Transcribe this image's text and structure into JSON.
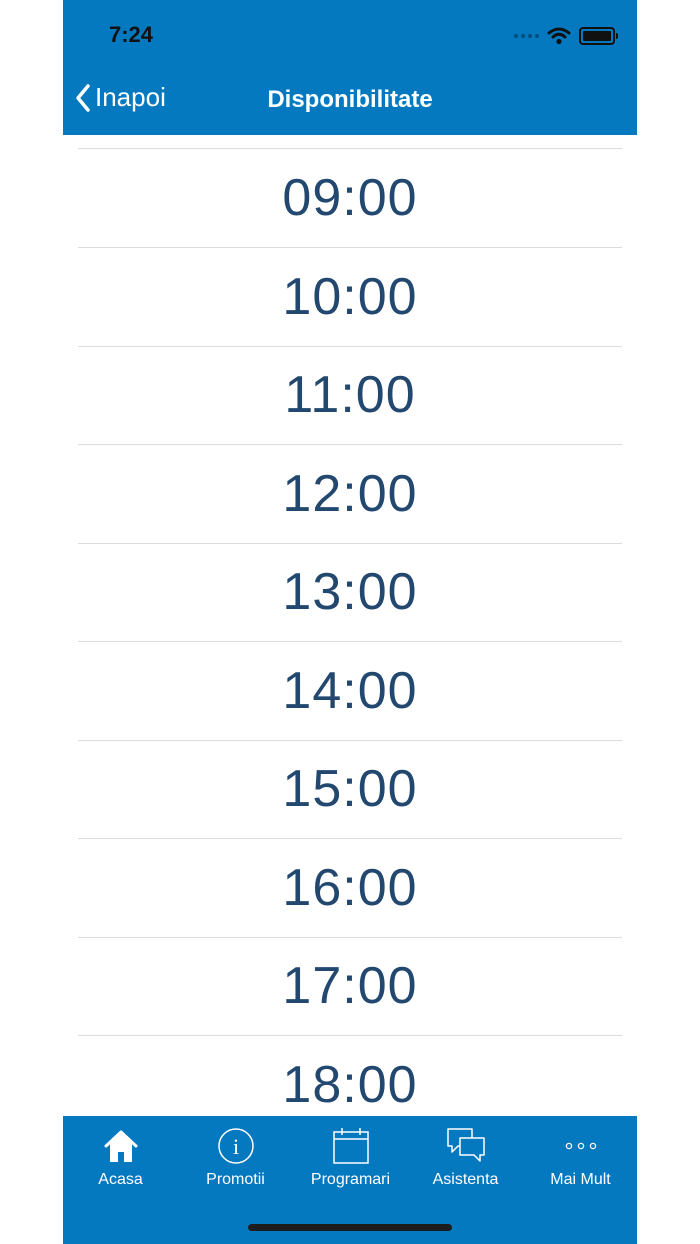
{
  "status_bar": {
    "time": "7:24"
  },
  "nav": {
    "back_label": "Inapoi",
    "title": "Disponibilitate"
  },
  "time_slots": [
    "09:00",
    "10:00",
    "11:00",
    "12:00",
    "13:00",
    "14:00",
    "15:00",
    "16:00",
    "17:00",
    "18:00"
  ],
  "tabs": [
    {
      "label": "Acasa",
      "icon": "home-icon"
    },
    {
      "label": "Promotii",
      "icon": "info-icon"
    },
    {
      "label": "Programari",
      "icon": "calendar-icon"
    },
    {
      "label": "Asistenta",
      "icon": "chat-icon"
    },
    {
      "label": "Mai Mult",
      "icon": "more-icon"
    }
  ],
  "colors": {
    "primary": "#0479bf",
    "slot_text": "#23486f"
  }
}
